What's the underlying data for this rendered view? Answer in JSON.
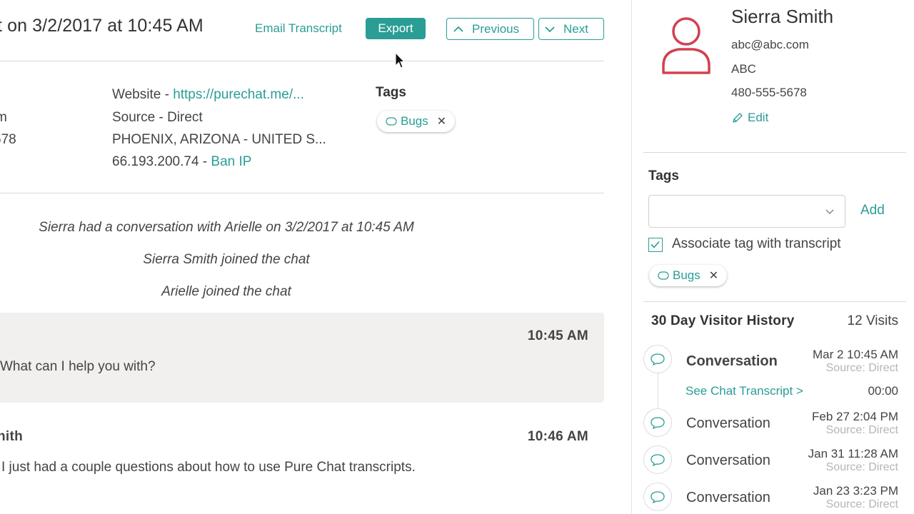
{
  "header": {
    "title": "t on 3/2/2017 at 10:45 AM",
    "email_transcript": "Email Transcript",
    "export": "Export",
    "previous": "Previous",
    "next": "Next"
  },
  "visitor_info": {
    "left_col": [
      "m",
      "678"
    ],
    "website_prefix": "Website - ",
    "website_url": "https://purechat.me/...",
    "source": "Source - Direct",
    "location": "PHOENIX, ARIZONA - UNITED S...",
    "ip": "66.193.200.74",
    "ip_sep": " - ",
    "ban_ip": "Ban IP",
    "tags_heading": "Tags",
    "tag": "Bugs"
  },
  "transcript": {
    "system_messages": [
      "Sierra had a conversation with Arielle on 3/2/2017 at 10:45 AM",
      "Sierra Smith joined the chat",
      "Arielle joined the chat"
    ],
    "messages": [
      {
        "sender": "",
        "time": "10:45 AM",
        "text": "What can I help you with?"
      },
      {
        "sender": "nith",
        "time": "10:46 AM",
        "text": "I just had a couple questions about how to use Pure Chat transcripts."
      }
    ]
  },
  "sidebar": {
    "name": "Sierra Smith",
    "email": "abc@abc.com",
    "company": "ABC",
    "phone": "480-555-5678",
    "edit": "Edit",
    "tags_heading": "Tags",
    "tag_select_value": "",
    "add": "Add",
    "associate_label": "Associate tag with transcript",
    "associate_checked": true,
    "tag": "Bugs",
    "history_title": "30 Day Visitor History",
    "history_count": "12 Visits",
    "history": [
      {
        "label": "Conversation",
        "date": "Mar 2 10:45 AM",
        "source": "Source: Direct",
        "bold": true
      },
      {
        "label": "Conversation",
        "date": "Feb 27 2:04 PM",
        "source": "Source: Direct",
        "bold": false
      },
      {
        "label": "Conversation",
        "date": "Jan 31 11:28 AM",
        "source": "Source: Direct",
        "bold": false
      },
      {
        "label": "Conversation",
        "date": "Jan 23 3:23 PM",
        "source": "Source: Direct",
        "bold": false
      }
    ],
    "see_transcript": "See Chat Transcript >",
    "duration": "00:00"
  },
  "colors": {
    "accent": "#2a9d95",
    "avatar": "#d2414f",
    "message_bg": "#f1f0ee"
  },
  "icons": {
    "previous": "chevron-up-icon",
    "next": "chevron-down-icon",
    "tag": "tag-icon",
    "remove": "close-icon",
    "edit": "pencil-icon",
    "select": "chevron-down-icon",
    "check": "checkmark-icon",
    "conversation": "chat-bubble-icon",
    "avatar": "user-icon",
    "cursor": "mouse-pointer-icon"
  }
}
